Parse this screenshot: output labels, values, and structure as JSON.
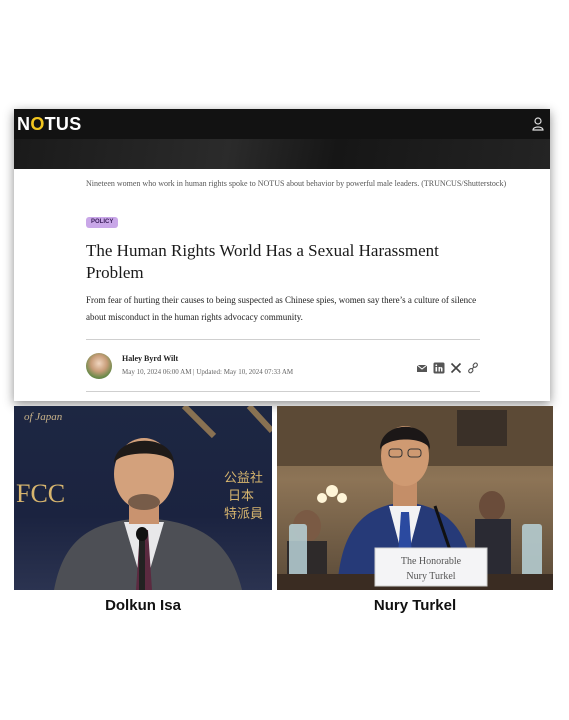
{
  "article": {
    "site_logo_prefix": "N",
    "site_logo_o": "O",
    "site_logo_suffix": "TUS",
    "image_caption": "Nineteen women who work in human rights spoke to NOTUS about behavior by powerful male leaders. (TRUNCUS/Shutterstock)",
    "tag": "POLICY",
    "headline": "The Human Rights World Has a Sexual Harassment Problem",
    "dek": "From fear of hurting their causes to being suspected as Chinese spies, women say there’s a culture of silence about misconduct in the human rights advocacy community.",
    "author": "Haley Byrd Wilt",
    "dates": "May 10, 2024 06:00 AM | Updated: May 10, 2024 07:33 AM",
    "share_icons": [
      "email-icon",
      "linkedin-icon",
      "x-icon",
      "link-icon"
    ],
    "colors": {
      "topbar": "#121212",
      "logo_accent": "#f2c61f",
      "tag_bg": "#c9a7e8"
    }
  },
  "photos": {
    "left": {
      "name": "Dolkun Isa",
      "backdrop_text_1": "of Japan",
      "backdrop_text_2": "FCC",
      "backdrop_text_3": "公益社\n日本\n特派員"
    },
    "right": {
      "name": "Nury Turkel",
      "placard": "The Honorable\nNury Turkel"
    }
  }
}
